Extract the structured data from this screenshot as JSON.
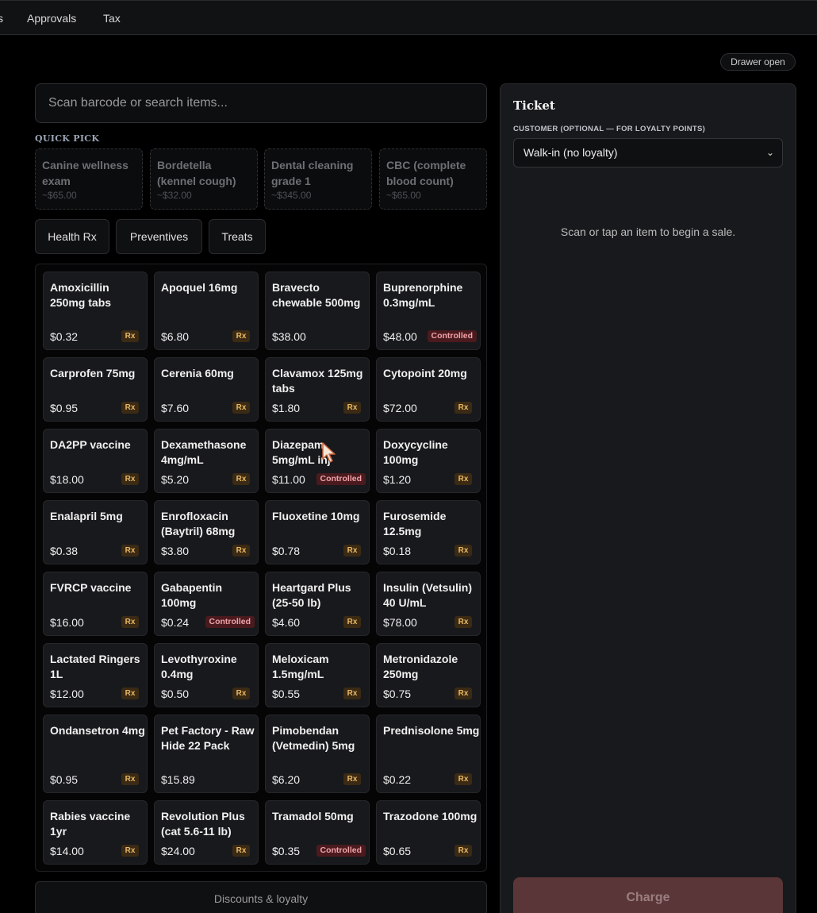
{
  "nav": {
    "partial_item": "s",
    "approvals": "Approvals",
    "tax": "Tax"
  },
  "drawer_status": "Drawer open",
  "search": {
    "placeholder": "Scan barcode or search items..."
  },
  "quick_pick": {
    "title": "QUICK PICK",
    "items": [
      {
        "name": "Canine wellness exam",
        "price": "~$65.00"
      },
      {
        "name": "Bordetella (kennel cough)",
        "price": "~$32.00"
      },
      {
        "name": "Dental cleaning grade 1",
        "price": "~$345.00"
      },
      {
        "name": "CBC (complete blood count)",
        "price": "~$65.00"
      }
    ]
  },
  "tabs": [
    "Health Rx",
    "Preventives",
    "Treats"
  ],
  "products": [
    {
      "name": "Amoxicillin 250mg tabs",
      "price": "$0.32",
      "badge": "Rx"
    },
    {
      "name": "Apoquel 16mg",
      "price": "$6.80",
      "badge": "Rx"
    },
    {
      "name": "Bravecto chewable 500mg",
      "price": "$38.00",
      "badge": ""
    },
    {
      "name": "Buprenorphine 0.3mg/mL",
      "price": "$48.00",
      "badge": "Controlled"
    },
    {
      "name": "Carprofen 75mg",
      "price": "$0.95",
      "badge": "Rx"
    },
    {
      "name": "Cerenia 60mg",
      "price": "$7.60",
      "badge": "Rx"
    },
    {
      "name": "Clavamox 125mg tabs",
      "price": "$1.80",
      "badge": "Rx"
    },
    {
      "name": "Cytopoint 20mg",
      "price": "$72.00",
      "badge": "Rx"
    },
    {
      "name": "DA2PP vaccine",
      "price": "$18.00",
      "badge": "Rx"
    },
    {
      "name": "Dexamethasone 4mg/mL",
      "price": "$5.20",
      "badge": "Rx"
    },
    {
      "name": "Diazepam 5mg/mL inj",
      "price": "$11.00",
      "badge": "Controlled"
    },
    {
      "name": "Doxycycline 100mg",
      "price": "$1.20",
      "badge": "Rx"
    },
    {
      "name": "Enalapril 5mg",
      "price": "$0.38",
      "badge": "Rx"
    },
    {
      "name": "Enrofloxacin (Baytril) 68mg",
      "price": "$3.80",
      "badge": "Rx"
    },
    {
      "name": "Fluoxetine 10mg",
      "price": "$0.78",
      "badge": "Rx"
    },
    {
      "name": "Furosemide 12.5mg",
      "price": "$0.18",
      "badge": "Rx"
    },
    {
      "name": "FVRCP vaccine",
      "price": "$16.00",
      "badge": "Rx"
    },
    {
      "name": "Gabapentin 100mg",
      "price": "$0.24",
      "badge": "Controlled"
    },
    {
      "name": "Heartgard Plus (25-50 lb)",
      "price": "$4.60",
      "badge": "Rx"
    },
    {
      "name": "Insulin (Vetsulin) 40 U/mL",
      "price": "$78.00",
      "badge": "Rx"
    },
    {
      "name": "Lactated Ringers 1L",
      "price": "$12.00",
      "badge": "Rx"
    },
    {
      "name": "Levothyroxine 0.4mg",
      "price": "$0.50",
      "badge": "Rx"
    },
    {
      "name": "Meloxicam 1.5mg/mL",
      "price": "$0.55",
      "badge": "Rx"
    },
    {
      "name": "Metronidazole 250mg",
      "price": "$0.75",
      "badge": "Rx"
    },
    {
      "name": "Ondansetron 4mg",
      "price": "$0.95",
      "badge": "Rx"
    },
    {
      "name": "Pet Factory - Raw Hide 22 Pack",
      "price": "$15.89",
      "badge": ""
    },
    {
      "name": "Pimobendan (Vetmedin) 5mg",
      "price": "$6.20",
      "badge": "Rx"
    },
    {
      "name": "Prednisolone 5mg",
      "price": "$0.22",
      "badge": "Rx"
    },
    {
      "name": "Rabies vaccine 1yr",
      "price": "$14.00",
      "badge": "Rx"
    },
    {
      "name": "Revolution Plus (cat 5.6-11 lb)",
      "price": "$24.00",
      "badge": "Rx"
    },
    {
      "name": "Tramadol 50mg",
      "price": "$0.35",
      "badge": "Controlled"
    },
    {
      "name": "Trazodone 100mg",
      "price": "$0.65",
      "badge": "Rx"
    }
  ],
  "discounts_label": "Discounts & loyalty",
  "ticket": {
    "title": "Ticket",
    "customer_label": "CUSTOMER (OPTIONAL — FOR LOYALTY POINTS)",
    "customer_value": "Walk-in (no loyalty)",
    "empty_message": "Scan or tap an item to begin a sale.",
    "charge_label": "Charge"
  },
  "colors": {
    "rx_badge_bg": "#3b2a14",
    "rx_badge_text": "#e8b862",
    "controlled_badge_bg": "#4a1a1e",
    "controlled_badge_text": "#f0a3a8",
    "charge_button": "#5b3638"
  }
}
